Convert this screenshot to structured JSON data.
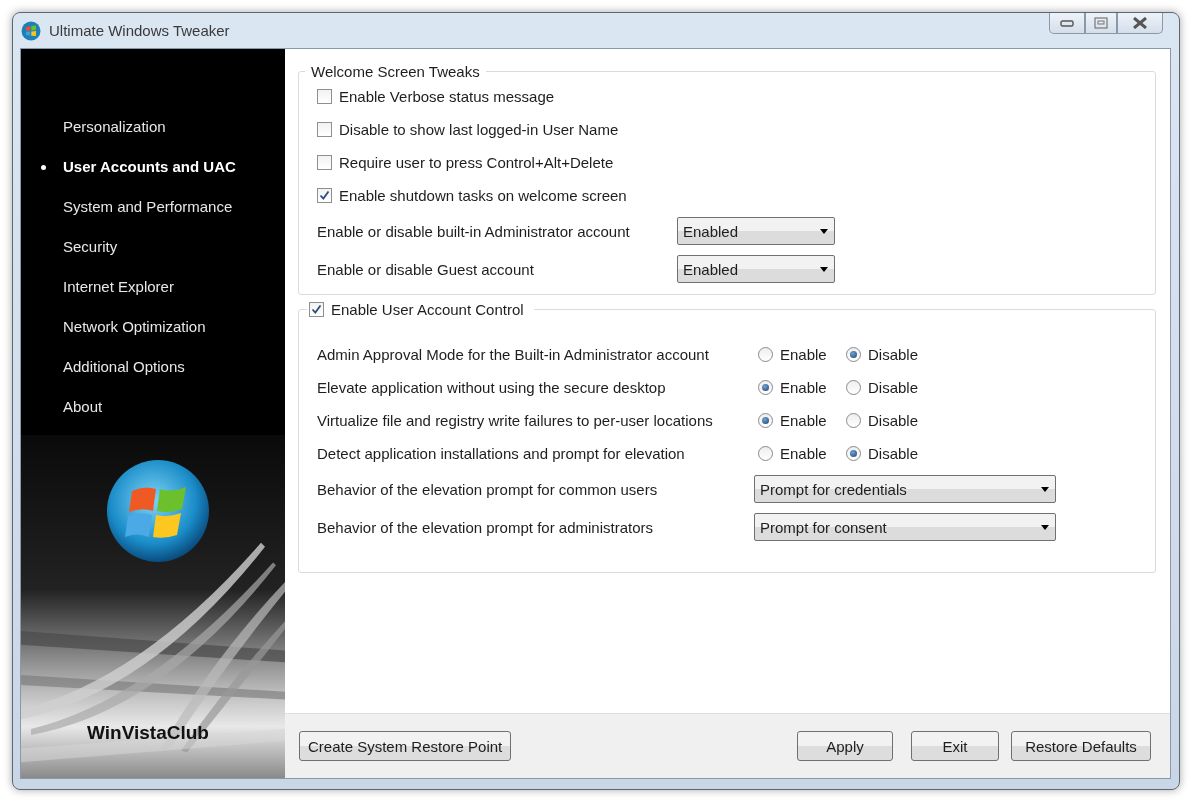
{
  "window": {
    "title": "Ultimate Windows Tweaker"
  },
  "sidebar": {
    "items": [
      {
        "label": "Personalization",
        "selected": false
      },
      {
        "label": "User Accounts and UAC",
        "selected": true
      },
      {
        "label": "System and Performance",
        "selected": false
      },
      {
        "label": "Security",
        "selected": false
      },
      {
        "label": "Internet Explorer",
        "selected": false
      },
      {
        "label": "Network Optimization",
        "selected": false
      },
      {
        "label": "Additional Options",
        "selected": false
      },
      {
        "label": "About",
        "selected": false
      }
    ],
    "brand": "WinVistaClub"
  },
  "welcome_group": {
    "title": "Welcome Screen Tweaks",
    "checkboxes": [
      {
        "label": "Enable Verbose status message",
        "checked": false
      },
      {
        "label": "Disable to show last logged-in User Name",
        "checked": false
      },
      {
        "label": "Require user to press Control+Alt+Delete",
        "checked": false
      },
      {
        "label": "Enable shutdown tasks on welcome screen",
        "checked": true
      }
    ],
    "dropdowns": [
      {
        "label": "Enable or disable built-in Administrator account",
        "value": "Enabled"
      },
      {
        "label": "Enable or disable Guest account",
        "value": "Enabled"
      }
    ]
  },
  "uac_group": {
    "title": "Enable User Account Control",
    "checked": true,
    "radio_rows": [
      {
        "label": "Admin Approval Mode for the Built-in Administrator account",
        "options": [
          {
            "label": "Enable",
            "selected": false
          },
          {
            "label": "Disable",
            "selected": true
          }
        ]
      },
      {
        "label": "Elevate application without using the secure desktop",
        "options": [
          {
            "label": "Enable",
            "selected": true
          },
          {
            "label": "Disable",
            "selected": false
          }
        ]
      },
      {
        "label": "Virtualize file and registry write failures to per-user locations",
        "options": [
          {
            "label": "Enable",
            "selected": true
          },
          {
            "label": "Disable",
            "selected": false
          }
        ]
      },
      {
        "label": "Detect application installations and prompt for elevation",
        "options": [
          {
            "label": "Enable",
            "selected": false
          },
          {
            "label": "Disable",
            "selected": true
          }
        ]
      }
    ],
    "dropdowns": [
      {
        "label": "Behavior of the elevation prompt for common users",
        "value": "Prompt for credentials"
      },
      {
        "label": "Behavior of the elevation prompt for administrators",
        "value": "Prompt for consent"
      }
    ]
  },
  "footer": {
    "left_button": "Create System Restore Point",
    "right_buttons": [
      "Apply",
      "Exit",
      "Restore Defaults"
    ]
  }
}
